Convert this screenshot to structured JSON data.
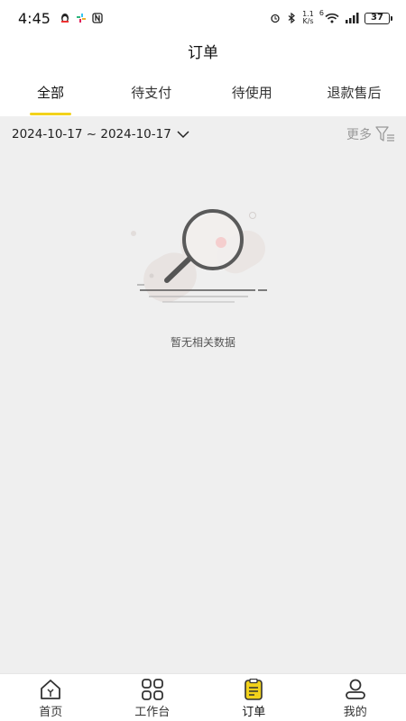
{
  "status_bar": {
    "time": "4:45",
    "speed_top": "1.1",
    "speed_bottom": "K/s",
    "wifi_gen": "6",
    "battery": "37"
  },
  "header": {
    "title": "订单"
  },
  "tabs": [
    {
      "label": "全部",
      "active": true
    },
    {
      "label": "待支付",
      "active": false
    },
    {
      "label": "待使用",
      "active": false
    },
    {
      "label": "退款售后",
      "active": false
    }
  ],
  "filter": {
    "date_range": "2024-10-17 ~ 2024-10-17",
    "more_label": "更多"
  },
  "empty_state": {
    "text": "暂无相关数据"
  },
  "colors": {
    "accent": "#f2d21b",
    "content_bg": "#efefef"
  },
  "bottom_nav": [
    {
      "label": "首页",
      "icon": "home-icon",
      "active": false
    },
    {
      "label": "工作台",
      "icon": "grid-icon",
      "active": false
    },
    {
      "label": "订单",
      "icon": "order-icon",
      "active": true
    },
    {
      "label": "我的",
      "icon": "profile-icon",
      "active": false
    }
  ]
}
